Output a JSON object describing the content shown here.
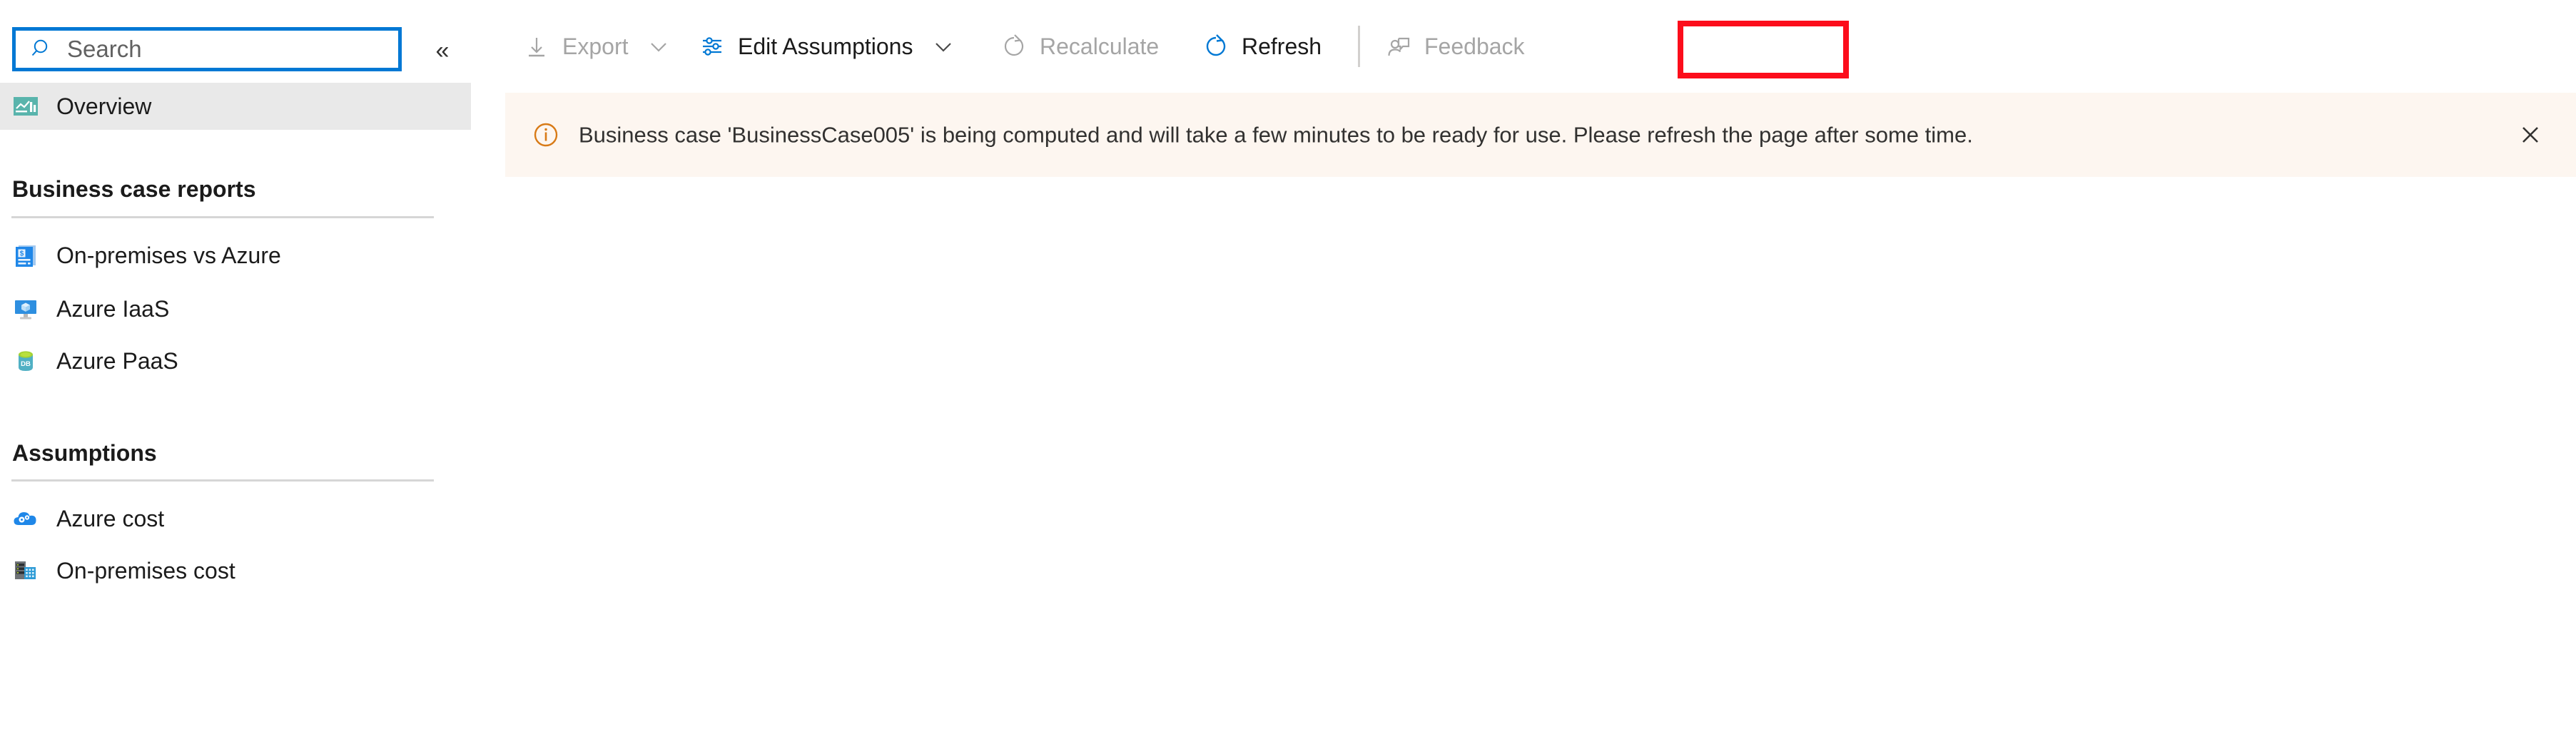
{
  "sidebar": {
    "search": {
      "placeholder": "Search",
      "value": "",
      "icon": "search-icon"
    },
    "collapse": {
      "label": "«",
      "icon": "chevron-double-left-icon"
    },
    "overview": {
      "label": "Overview",
      "icon": "report-analytics-icon",
      "selected": true
    },
    "sections": [
      {
        "title": "Business case reports",
        "items": [
          {
            "label": "On-premises vs Azure",
            "icon": "invoice-dollar-icon"
          },
          {
            "label": "Azure IaaS",
            "icon": "virtual-machine-icon"
          },
          {
            "label": "Azure PaaS",
            "icon": "database-icon"
          }
        ]
      },
      {
        "title": "Assumptions",
        "items": [
          {
            "label": "Azure cost",
            "icon": "cloud-gear-icon"
          },
          {
            "label": "On-premises cost",
            "icon": "server-building-icon"
          }
        ]
      }
    ]
  },
  "toolbar": {
    "items": [
      {
        "label": "Export",
        "icon": "download-icon",
        "caret": true,
        "disabled": true
      },
      {
        "label": "Edit Assumptions",
        "icon": "sliders-icon",
        "caret": true,
        "disabled": false
      },
      {
        "label": "Recalculate",
        "icon": "refresh-circle-icon",
        "caret": false,
        "disabled": true
      },
      {
        "label": "Refresh",
        "icon": "refresh-circle-icon",
        "caret": false,
        "disabled": false,
        "highlighted": true
      },
      {
        "label": "Feedback",
        "icon": "person-feedback-icon",
        "caret": false,
        "disabled": true
      }
    ]
  },
  "banner": {
    "icon": "info-circle-icon",
    "message": "Business case 'BusinessCase005' is being computed and will take a few minutes to be ready for use. Please refresh the page after some time.",
    "close_icon": "close-icon",
    "background": "#fdf6f0",
    "icon_color": "#d87a16"
  },
  "annotation": {
    "highlight_color": "#fc0d1b",
    "target": "Refresh"
  },
  "colors": {
    "accent": "#0078d4",
    "selected_row": "#e9e9e9",
    "disabled_text": "#a5a5a5",
    "text": "#1b1b1b"
  }
}
